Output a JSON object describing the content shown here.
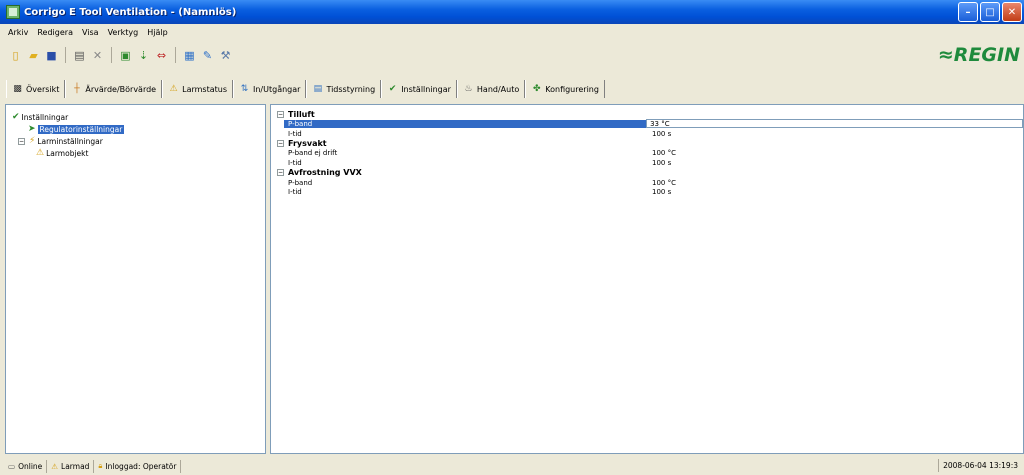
{
  "window": {
    "title": "Corrigo E Tool Ventilation - (Namnlös)"
  },
  "menu": [
    {
      "label": "Arkiv"
    },
    {
      "label": "Redigera"
    },
    {
      "label": "Visa"
    },
    {
      "label": "Verktyg"
    },
    {
      "label": "Hjälp"
    }
  ],
  "toolbar": {
    "icons": [
      "new-file-icon",
      "open-folder-icon",
      "save-icon",
      "print-icon",
      "delete-icon",
      "properties-icon",
      "connect-icon",
      "transfer-icon",
      "chart-icon",
      "edit-icon",
      "wrench-icon"
    ]
  },
  "brand": {
    "logo_text": "≈REGIN",
    "color": "#1e8a3c"
  },
  "tabs": [
    {
      "label": "Översikt",
      "icon": "overview-icon"
    },
    {
      "label": "Ärvärde/Börvärde",
      "icon": "setpoint-icon"
    },
    {
      "label": "Larmstatus",
      "icon": "alarm-icon"
    },
    {
      "label": "In/Utgångar",
      "icon": "io-icon"
    },
    {
      "label": "Tidsstyrning",
      "icon": "calendar-icon"
    },
    {
      "label": "Inställningar",
      "icon": "settings-icon"
    },
    {
      "label": "Hand/Auto",
      "icon": "hand-icon"
    },
    {
      "label": "Konfigurering",
      "icon": "config-icon"
    }
  ],
  "tree": {
    "root": "Inställningar",
    "regulator": "Regulatorinställningar",
    "alarm_settings": "Larminställningar",
    "alarm_object": "Larmobjekt"
  },
  "groups": [
    {
      "title": "Tilluft",
      "rows": [
        {
          "name": "P-band",
          "value": "33 °C"
        },
        {
          "name": "I-tid",
          "value": "100 s"
        }
      ]
    },
    {
      "title": "Frysvakt",
      "rows": [
        {
          "name": "P-band ej drift",
          "value": "100 °C"
        },
        {
          "name": "I-tid",
          "value": "100 s"
        }
      ]
    },
    {
      "title": "Avfrostning VVX",
      "rows": [
        {
          "name": "P-band",
          "value": "100 °C"
        },
        {
          "name": "I-tid",
          "value": "100 s"
        }
      ]
    }
  ],
  "status": {
    "online": "Online",
    "alarm": "Larmad",
    "user": "Inloggad: Operatör",
    "timestamp": "2008-06-04 13:19:3"
  }
}
